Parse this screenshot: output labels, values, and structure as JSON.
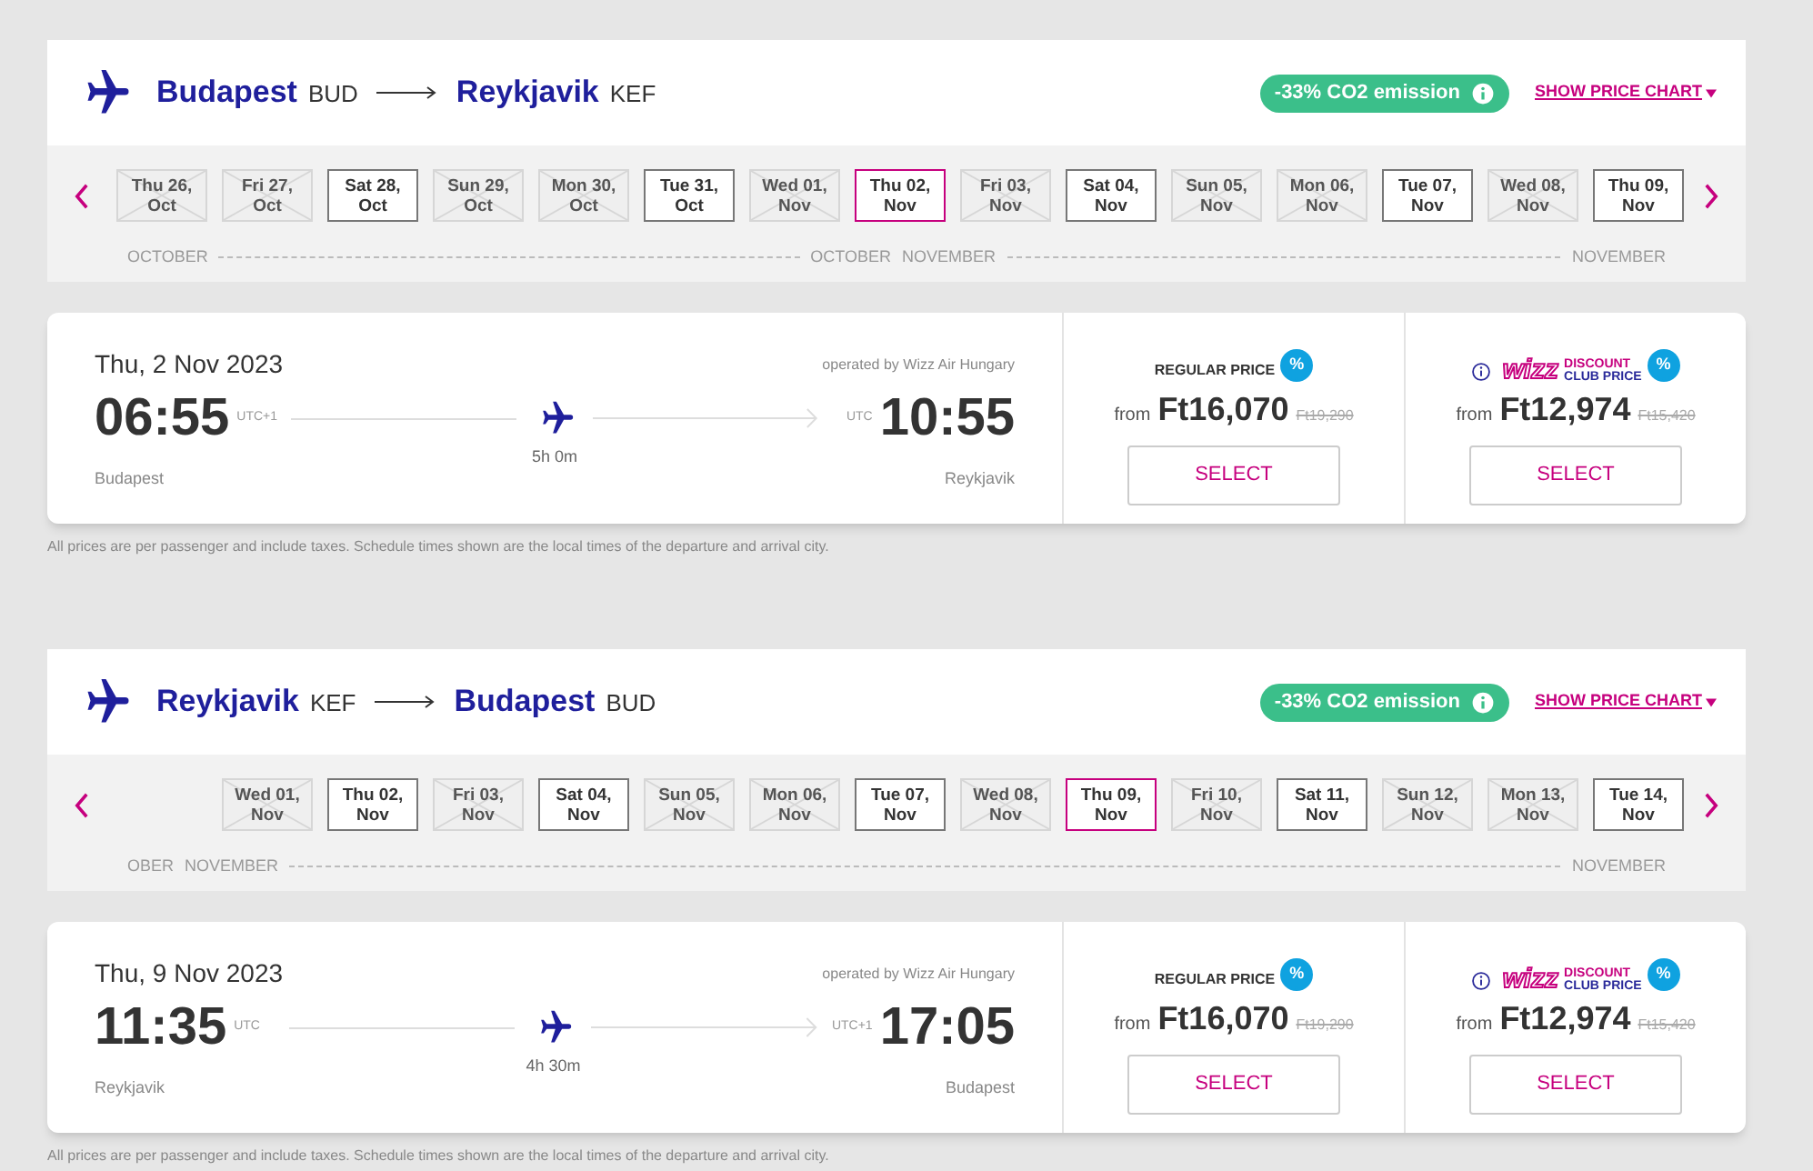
{
  "journeys": [
    {
      "from_city": "Budapest",
      "from_code": "BUD",
      "to_city": "Reykjavik",
      "to_code": "KEF",
      "emission": "-33% CO2 emission",
      "chart_link": "SHOW PRICE CHART",
      "dates": [
        {
          "day": "Thu 26,",
          "month": "Oct",
          "available": false,
          "selected": false
        },
        {
          "day": "Fri 27,",
          "month": "Oct",
          "available": false,
          "selected": false
        },
        {
          "day": "Sat 28,",
          "month": "Oct",
          "available": true,
          "selected": false
        },
        {
          "day": "Sun 29,",
          "month": "Oct",
          "available": false,
          "selected": false
        },
        {
          "day": "Mon 30,",
          "month": "Oct",
          "available": false,
          "selected": false
        },
        {
          "day": "Tue 31,",
          "month": "Oct",
          "available": true,
          "selected": false
        },
        {
          "day": "Wed 01,",
          "month": "Nov",
          "available": false,
          "selected": false
        },
        {
          "day": "Thu 02,",
          "month": "Nov",
          "available": true,
          "selected": true
        },
        {
          "day": "Fri 03,",
          "month": "Nov",
          "available": false,
          "selected": false
        },
        {
          "day": "Sat 04,",
          "month": "Nov",
          "available": true,
          "selected": false
        },
        {
          "day": "Sun 05,",
          "month": "Nov",
          "available": false,
          "selected": false
        },
        {
          "day": "Mon 06,",
          "month": "Nov",
          "available": false,
          "selected": false
        },
        {
          "day": "Tue 07,",
          "month": "Nov",
          "available": true,
          "selected": false
        },
        {
          "day": "Wed 08,",
          "month": "Nov",
          "available": false,
          "selected": false
        },
        {
          "day": "Thu 09,",
          "month": "Nov",
          "available": true,
          "selected": false
        }
      ],
      "month_segments": [
        {
          "labels": [
            "OCTOBER",
            "OCTOBER"
          ]
        },
        {
          "labels": [
            "NOVEMBER",
            "NOVEMBER"
          ]
        }
      ],
      "flight": {
        "date": "Thu, 2 Nov 2023",
        "operator": "operated by Wizz Air Hungary",
        "dep_time": "06:55",
        "dep_tz": "UTC+1",
        "dep_city": "Budapest",
        "duration": "5h 0m",
        "arr_tz": "UTC",
        "arr_time": "10:55",
        "arr_city": "Reykjavik"
      },
      "fares": [
        {
          "kind": "regular",
          "label": "REGULAR PRICE",
          "badge": "%",
          "from": "from",
          "price": "Ft16,070",
          "old_price": "Ft19,290",
          "button": "SELECT"
        },
        {
          "kind": "club",
          "logo": "wizz",
          "label_top": "DISCOUNT",
          "label_bottom": "CLUB PRICE",
          "badge": "%",
          "from": "from",
          "price": "Ft12,974",
          "old_price": "Ft15,420",
          "button": "SELECT"
        }
      ],
      "note": "All prices are per passenger and include taxes. Schedule times shown are the local times of the departure and arrival city."
    },
    {
      "from_city": "Reykjavik",
      "from_code": "KEF",
      "to_city": "Budapest",
      "to_code": "BUD",
      "emission": "-33% CO2 emission",
      "chart_link": "SHOW PRICE CHART",
      "dates": [
        {
          "day": "Wed 01,",
          "month": "Nov",
          "available": false,
          "selected": false
        },
        {
          "day": "Thu 02,",
          "month": "Nov",
          "available": true,
          "selected": false
        },
        {
          "day": "Fri 03,",
          "month": "Nov",
          "available": false,
          "selected": false
        },
        {
          "day": "Sat 04,",
          "month": "Nov",
          "available": true,
          "selected": false
        },
        {
          "day": "Sun 05,",
          "month": "Nov",
          "available": false,
          "selected": false
        },
        {
          "day": "Mon 06,",
          "month": "Nov",
          "available": false,
          "selected": false
        },
        {
          "day": "Tue 07,",
          "month": "Nov",
          "available": true,
          "selected": false
        },
        {
          "day": "Wed 08,",
          "month": "Nov",
          "available": false,
          "selected": false
        },
        {
          "day": "Thu 09,",
          "month": "Nov",
          "available": true,
          "selected": true
        },
        {
          "day": "Fri 10,",
          "month": "Nov",
          "available": false,
          "selected": false
        },
        {
          "day": "Sat 11,",
          "month": "Nov",
          "available": true,
          "selected": false
        },
        {
          "day": "Sun 12,",
          "month": "Nov",
          "available": false,
          "selected": false
        },
        {
          "day": "Mon 13,",
          "month": "Nov",
          "available": false,
          "selected": false
        },
        {
          "day": "Tue 14,",
          "month": "Nov",
          "available": true,
          "selected": false
        }
      ],
      "month_segments": [
        {
          "labels": [
            "OBER"
          ]
        },
        {
          "labels": [
            "NOVEMBER",
            "NOVEMBER"
          ]
        }
      ],
      "flight": {
        "date": "Thu, 9 Nov 2023",
        "operator": "operated by Wizz Air Hungary",
        "dep_time": "11:35",
        "dep_tz": "UTC",
        "dep_city": "Reykjavik",
        "duration": "4h 30m",
        "arr_tz": "UTC+1",
        "arr_time": "17:05",
        "arr_city": "Budapest"
      },
      "fares": [
        {
          "kind": "regular",
          "label": "REGULAR PRICE",
          "badge": "%",
          "from": "from",
          "price": "Ft16,070",
          "old_price": "Ft19,290",
          "button": "SELECT"
        },
        {
          "kind": "club",
          "logo": "wizz",
          "label_top": "DISCOUNT",
          "label_bottom": "CLUB PRICE",
          "badge": "%",
          "from": "from",
          "price": "Ft12,974",
          "old_price": "Ft15,420",
          "button": "SELECT"
        }
      ],
      "note": "All prices are per passenger and include taxes. Schedule times shown are the local times of the departure and arrival city."
    }
  ]
}
